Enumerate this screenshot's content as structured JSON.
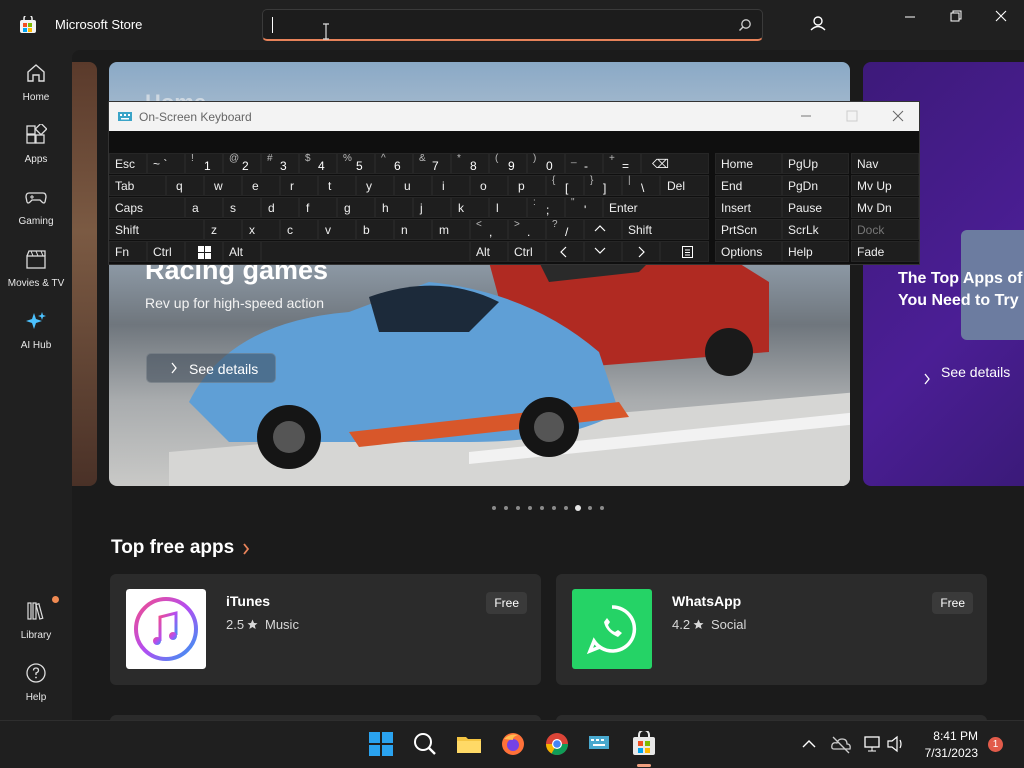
{
  "app": {
    "title": "Microsoft Store"
  },
  "search": {
    "placeholder": "",
    "value": ""
  },
  "nav": {
    "items": [
      {
        "label": "Home",
        "icon": "home-icon"
      },
      {
        "label": "Apps",
        "icon": "apps-icon"
      },
      {
        "label": "Gaming",
        "icon": "gaming-icon"
      },
      {
        "label": "Movies & TV",
        "icon": "movies-icon"
      },
      {
        "label": "AI Hub",
        "icon": "ai-hub-icon"
      },
      {
        "label": "Library",
        "icon": "library-icon"
      },
      {
        "label": "Help",
        "icon": "help-icon"
      }
    ]
  },
  "hero": {
    "page_title": "Home",
    "title": "Racing games",
    "subtitle": "Rev up for high-speed action",
    "button": "See details"
  },
  "hero_right": {
    "title": "The Top Apps of You Need to Try",
    "button": "See details"
  },
  "carousel": {
    "count": 10,
    "active_index": 7
  },
  "section": {
    "title": "Top free apps"
  },
  "apps": [
    {
      "name": "iTunes",
      "rating": "2.5",
      "category": "Music",
      "price": "Free"
    },
    {
      "name": "WhatsApp",
      "rating": "4.2",
      "category": "Social",
      "price": "Free"
    }
  ],
  "osk": {
    "title": "On-Screen Keyboard",
    "row1": {
      "esc": "Esc",
      "del_label": "⌫"
    },
    "nav_keys": {
      "home": "Home",
      "pgup": "PgUp",
      "nav": "Nav",
      "end": "End",
      "pgdn": "PgDn",
      "mvup": "Mv Up",
      "insert": "Insert",
      "pause": "Pause",
      "mvdn": "Mv Dn",
      "prtscn": "PrtScn",
      "scrlk": "ScrLk",
      "dock": "Dock",
      "options": "Options",
      "help": "Help",
      "fade": "Fade"
    },
    "mods": {
      "tab": "Tab",
      "caps": "Caps",
      "shift": "Shift",
      "fn": "Fn",
      "ctrl": "Ctrl",
      "alt": "Alt",
      "enter": "Enter",
      "del": "Del"
    }
  },
  "taskbar": {
    "time": "8:41 PM",
    "date": "7/31/2023",
    "notifications": "1"
  },
  "colors": {
    "accent": "#e8835a",
    "whatsapp": "#25d366",
    "ai_hub": "#4cc2ff"
  }
}
